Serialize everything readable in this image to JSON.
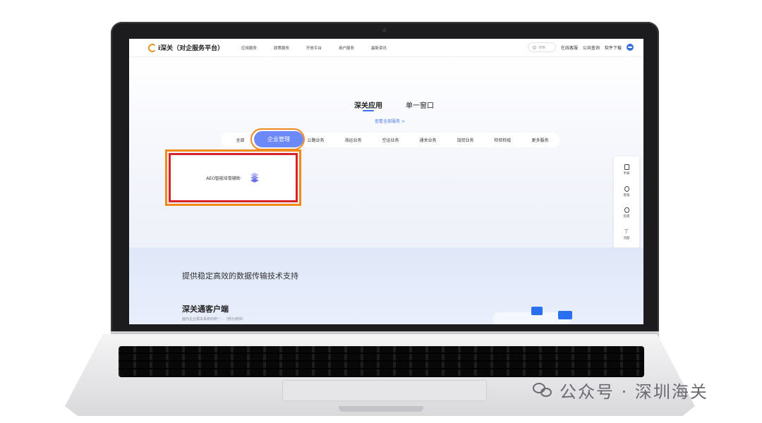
{
  "app": {
    "logo_text": "i深关（对企服务平台）",
    "nav": [
      "应用服务",
      "政策服务",
      "开放平台",
      "用户服务",
      "最新资讯"
    ],
    "search_placeholder": "搜索",
    "top_links": [
      "在线客服",
      "公共查询",
      "软件下载"
    ]
  },
  "section_tabs": [
    "深关应用",
    "单一窗口"
  ],
  "view_all": "查看全部服务  >",
  "categories": [
    "全部",
    "企业管理",
    "公路业务",
    "海运业务",
    "空运业务",
    "通关业务",
    "加贸业务",
    "检验检疫",
    "更多服务"
  ],
  "selected_category": "企业管理",
  "app_card": {
    "label": "AEO智能培育辅助",
    "icon": "layers-icon"
  },
  "float_bar": [
    "手册",
    "客服",
    "指南",
    "顶部"
  ],
  "lower": {
    "slogan": "提供稳定高效的数据传输技术支持",
    "client_title": "深关通客户端",
    "client_desc": "面向企业报关系统的统一...（部分遮挡）"
  },
  "watermark": "公众号 · 深圳海关",
  "colors": {
    "accent": "#6d89f7",
    "highlight_orange": "#f28a1a",
    "highlight_red": "#d8232a",
    "link_blue": "#4a7cf0"
  }
}
